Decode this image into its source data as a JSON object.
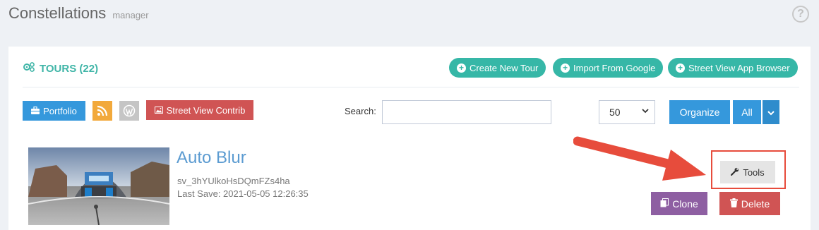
{
  "app": {
    "title": "Constellations",
    "subtitle": "manager",
    "help_glyph": "?"
  },
  "panel": {
    "tours_label": "TOURS (22)",
    "actions": [
      {
        "label": "Create New Tour",
        "icon": "plus-circle-icon"
      },
      {
        "label": "Import From Google",
        "icon": "plus-circle-icon"
      },
      {
        "label": "Street View App Browser",
        "icon": "plus-circle-icon"
      }
    ]
  },
  "toolbar": {
    "portfolio_label": "Portfolio",
    "street_view_contrib_label": "Street View Contrib",
    "search_label": "Search:",
    "search_value": "",
    "page_size": "50",
    "organize_label": "Organize",
    "filter_label": "All"
  },
  "tour": {
    "title": "Auto Blur",
    "id": "sv_3hYUlkoHsDQmFZs4ha",
    "last_save": "Last Save: 2021-05-05 12:26:35",
    "tools_label": "Tools",
    "clone_label": "Clone",
    "delete_label": "Delete"
  },
  "colors": {
    "teal": "#36b7a7",
    "blue": "#3598dc",
    "red": "#d05454",
    "purple": "#8e5fa2",
    "rss_orange": "#f2a93b",
    "wordpress_grey": "#c5c5c5",
    "annotation_red": "#e74c3c"
  }
}
